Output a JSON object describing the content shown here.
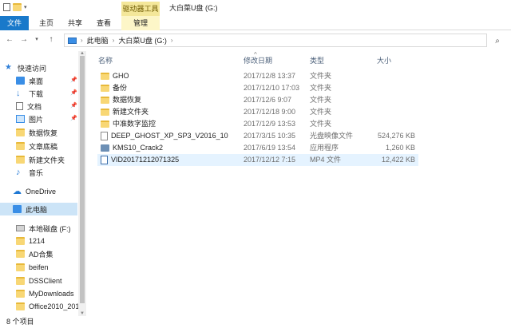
{
  "title_bar": {
    "contextual_tab": "驱动器工具",
    "window_title": "大白菜U盘 (G:)"
  },
  "ribbon": {
    "tabs": [
      "文件",
      "主页",
      "共享",
      "查看",
      "管理"
    ]
  },
  "address": {
    "crumbs": [
      "此电脑",
      "大白菜U盘 (G:)"
    ]
  },
  "nav": {
    "items": [
      {
        "label": "快速访问",
        "icon": "star-icon",
        "pinned": false
      },
      {
        "label": "桌面",
        "icon": "desktop-icon",
        "pinned": true
      },
      {
        "label": "下载",
        "icon": "download-icon",
        "pinned": true
      },
      {
        "label": "文档",
        "icon": "document-icon",
        "pinned": true
      },
      {
        "label": "图片",
        "icon": "picture-icon",
        "pinned": true
      },
      {
        "label": "数据恢复",
        "icon": "folder-icon",
        "pinned": false
      },
      {
        "label": "文章底稿",
        "icon": "folder-icon",
        "pinned": false
      },
      {
        "label": "新建文件夹",
        "icon": "folder-icon",
        "pinned": false
      },
      {
        "label": "音乐",
        "icon": "music-icon",
        "pinned": false
      },
      {
        "label": "OneDrive",
        "icon": "cloud-icon",
        "pinned": false
      },
      {
        "label": "此电脑",
        "icon": "computer-icon",
        "pinned": false
      },
      {
        "label": "本地磁盘 (F:)",
        "icon": "drive-icon",
        "pinned": false
      },
      {
        "label": "1214",
        "icon": "folder-icon",
        "pinned": false
      },
      {
        "label": "AD合集",
        "icon": "folder-icon",
        "pinned": false
      },
      {
        "label": "beifen",
        "icon": "folder-icon",
        "pinned": false
      },
      {
        "label": "DSSClient",
        "icon": "folder-icon",
        "pinned": false
      },
      {
        "label": "MyDownloads",
        "icon": "folder-icon",
        "pinned": false
      },
      {
        "label": "Office2010_201",
        "icon": "folder-icon",
        "pinned": false
      }
    ]
  },
  "columns": {
    "name": "名称",
    "date": "修改日期",
    "type": "类型",
    "size": "大小"
  },
  "files": [
    {
      "name": "GHO",
      "date": "2017/12/8 13:37",
      "type": "文件夹",
      "size": "",
      "icon": "folder-icon"
    },
    {
      "name": "备份",
      "date": "2017/12/10 17:03",
      "type": "文件夹",
      "size": "",
      "icon": "folder-icon"
    },
    {
      "name": "数据恢复",
      "date": "2017/12/6 9:07",
      "type": "文件夹",
      "size": "",
      "icon": "folder-icon"
    },
    {
      "name": "新建文件夹",
      "date": "2017/12/18 9:00",
      "type": "文件夹",
      "size": "",
      "icon": "folder-icon"
    },
    {
      "name": "中准数字监控",
      "date": "2017/12/9 13:53",
      "type": "文件夹",
      "size": "",
      "icon": "folder-icon"
    },
    {
      "name": "DEEP_GHOST_XP_SP3_V2016_10",
      "date": "2017/3/15 10:35",
      "type": "光盘映像文件",
      "size": "524,276 KB",
      "icon": "disc-image-icon"
    },
    {
      "name": "KMS10_Crack2",
      "date": "2017/6/19 13:54",
      "type": "应用程序",
      "size": "1,260 KB",
      "icon": "application-icon"
    },
    {
      "name": "VID20171212071325",
      "date": "2017/12/12 7:15",
      "type": "MP4 文件",
      "size": "12,422 KB",
      "icon": "video-file-icon"
    }
  ],
  "status": {
    "count": "8 个项目"
  }
}
